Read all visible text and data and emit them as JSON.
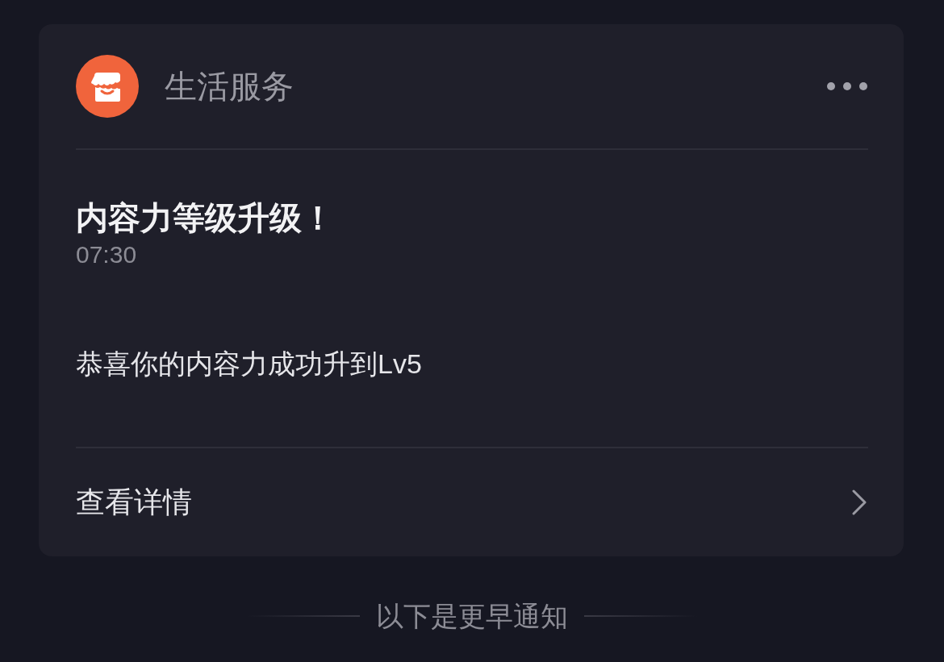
{
  "app": {
    "name": "生活服务"
  },
  "notification": {
    "title": "内容力等级升级！",
    "time": "07:30",
    "body": "恭喜你的内容力成功升到Lv5"
  },
  "action": {
    "label": "查看详情"
  },
  "separator": {
    "label": "以下是更早通知"
  }
}
